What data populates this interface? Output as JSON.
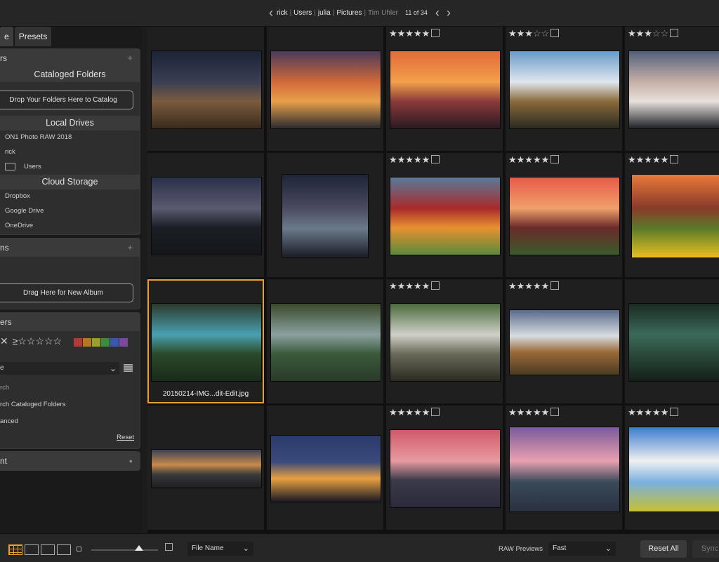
{
  "topbar": {
    "crumbs": [
      "rick",
      "Users",
      "julia",
      "Pictures"
    ],
    "muted_crumb": "Tim Uhler",
    "counter": "11 of 34"
  },
  "left": {
    "tabs": [
      "e",
      "Presets"
    ],
    "folders_panel": {
      "header": "rs",
      "plus": "+",
      "cataloged_title": "Cataloged Folders",
      "drop_button": "Drop Your Folders Here to Catalog",
      "local_title": "Local Drives",
      "local_items": [
        "ON1 Photo RAW 2018",
        "rick",
        "Users"
      ],
      "cloud_title": "Cloud Storage",
      "cloud_items": [
        "Dropbox",
        "Google Drive",
        "OneDrive"
      ]
    },
    "albums_panel": {
      "header": "ns",
      "plus": "+",
      "new_album_button": "Drag Here for New Album"
    },
    "filters_panel": {
      "header": "ers",
      "rating_label": "≥☆☆☆☆☆",
      "color_swatches": [
        "#b03a3a",
        "#b07a2a",
        "#9aa02a",
        "#3e8a3e",
        "#3a5aa8",
        "#7a4a9a"
      ],
      "select_value": "e",
      "search_label": "rch",
      "search_option": "rch Cataloged Folders",
      "advanced_label": "anced",
      "reset_label": "Reset"
    },
    "bottom_panel": {
      "header": "nt"
    }
  },
  "grid": {
    "selected_filename": "20150214-IMG...dit-Edit.jpg",
    "rows": [
      [
        {
          "stars": 0,
          "gradient": [
            "#1b2335",
            "#3a3f55",
            "#7a5b3e",
            "#3a2a1e"
          ]
        },
        {
          "stars": 0,
          "gradient": [
            "#4a3a5a",
            "#d26a3a",
            "#e8a04a",
            "#2a2a30"
          ]
        },
        {
          "stars": 5,
          "gradient": [
            "#e36a3a",
            "#f2a04a",
            "#8a3a3a",
            "#2a1a22"
          ]
        },
        {
          "stars": 3,
          "gradient": [
            "#6a9ac8",
            "#dfe6ee",
            "#8a6a3a",
            "#2a2a22"
          ]
        },
        {
          "stars": 3,
          "gradient": [
            "#52607a",
            "#c8b0a8",
            "#e8e0dc",
            "#1e2228"
          ]
        }
      ],
      [
        {
          "stars": 0,
          "gradient": [
            "#2a3048",
            "#5a5a70",
            "#1a1e24",
            "#14161a"
          ]
        },
        {
          "stars": 0,
          "gradient": [
            "#1e2436",
            "#4a4a60",
            "#6a7a8a",
            "#1a1c24"
          ]
        },
        {
          "stars": 5,
          "gradient": [
            "#5a7a9a",
            "#a82a2a",
            "#e89030",
            "#5a8a3a"
          ]
        },
        {
          "stars": 5,
          "gradient": [
            "#e85a4a",
            "#f0a06a",
            "#6a2a2a",
            "#3a5a2a"
          ]
        },
        {
          "stars": 5,
          "gradient": [
            "#e87a3a",
            "#8a3a2a",
            "#5a7a2a",
            "#e8c020"
          ]
        }
      ],
      [
        {
          "stars": 0,
          "gradient": [
            "#2a3a2a",
            "#4aa0b0",
            "#2a4a2a",
            "#1a2a1a"
          ]
        },
        {
          "stars": 0,
          "gradient": [
            "#3a4a2a",
            "#8aa0a0",
            "#3a5a3a",
            "#2a3a2a"
          ]
        },
        {
          "stars": 5,
          "gradient": [
            "#4a6a3a",
            "#d0d0c8",
            "#6a6a5a",
            "#2a2a22"
          ]
        },
        {
          "stars": 5,
          "gradient": [
            "#5a6a8a",
            "#d8dce0",
            "#9a6a3a",
            "#4a3a22"
          ]
        },
        {
          "stars": 0,
          "gradient": [
            "#1a2a22",
            "#3a6a5a",
            "#2a4a3a",
            "#14201a"
          ]
        }
      ],
      [
        {
          "stars": 0,
          "gradient": [
            "#3a4258",
            "#c88a4a",
            "#3a3a3a",
            "#1e1e22"
          ]
        },
        {
          "stars": 0,
          "gradient": [
            "#2a3a6a",
            "#3a4a7a",
            "#e8a040",
            "#1a1a24"
          ]
        },
        {
          "stars": 5,
          "gradient": [
            "#d05a6a",
            "#e89aa0",
            "#3a3a4a",
            "#2a2a3a"
          ]
        },
        {
          "stars": 5,
          "gradient": [
            "#7a5a9a",
            "#e8a0b0",
            "#3a4a5a",
            "#2a3040"
          ]
        },
        {
          "stars": 5,
          "gradient": [
            "#3a7ad0",
            "#f0f0f0",
            "#7ab0e0",
            "#c8c030"
          ]
        }
      ]
    ]
  },
  "bottombar": {
    "sort_value": "File Name",
    "raw_label": "RAW Previews",
    "raw_value": "Fast",
    "reset_all": "Reset All",
    "sync": "Sync",
    "thumbnail_size": 0.5
  }
}
